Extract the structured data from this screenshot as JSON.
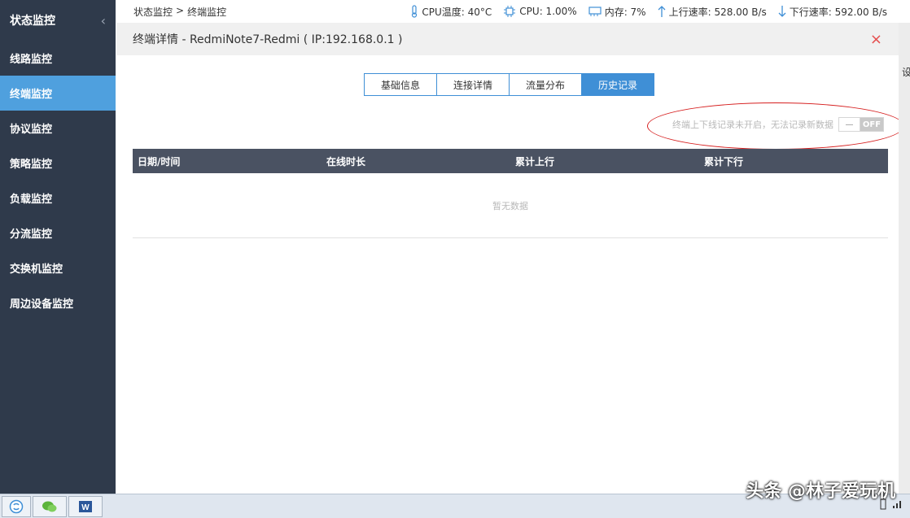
{
  "sidebar": {
    "title": "状态监控",
    "collapse_icon": "chevron-left-icon",
    "items": [
      {
        "label": "线路监控",
        "active": false
      },
      {
        "label": "终端监控",
        "active": true
      },
      {
        "label": "协议监控",
        "active": false
      },
      {
        "label": "策略监控",
        "active": false
      },
      {
        "label": "负载监控",
        "active": false
      },
      {
        "label": "分流监控",
        "active": false
      },
      {
        "label": "交换机监控",
        "active": false
      },
      {
        "label": "周边设备监控",
        "active": false
      }
    ]
  },
  "topbar": {
    "breadcrumb": [
      "状态监控",
      ">",
      "终端监控"
    ],
    "cpu_temp": "CPU温度: 40°C",
    "cpu": "CPU: 1.00%",
    "memory": "内存: 7%",
    "upload": "上行速率: 528.00 B/s",
    "download": "下行速率: 592.00 B/s"
  },
  "modal": {
    "title": "终端详情 - RedmiNote7-Redmi ( IP:192.168.0.1 )",
    "close": "×",
    "tabs": [
      {
        "label": "基础信息",
        "active": false
      },
      {
        "label": "连接详情",
        "active": false
      },
      {
        "label": "流量分布",
        "active": false
      },
      {
        "label": "历史记录",
        "active": true
      }
    ],
    "notice": "终端上下线记录未开启，无法记录新数据",
    "toggle_knob": "—",
    "toggle_label": "OFF",
    "table": {
      "columns": [
        "日期/时间",
        "在线时长",
        "累计上行",
        "累计下行"
      ],
      "empty": "暂无数据"
    }
  },
  "right_strip_char": "设",
  "watermark": "头条 @林子爱玩机",
  "colors": {
    "sidebar_bg": "#2f3a4b",
    "active_nav": "#4fa0de",
    "tab_accent": "#3f8fd6",
    "table_head": "#4a5262",
    "annotation": "#d61f1f"
  }
}
